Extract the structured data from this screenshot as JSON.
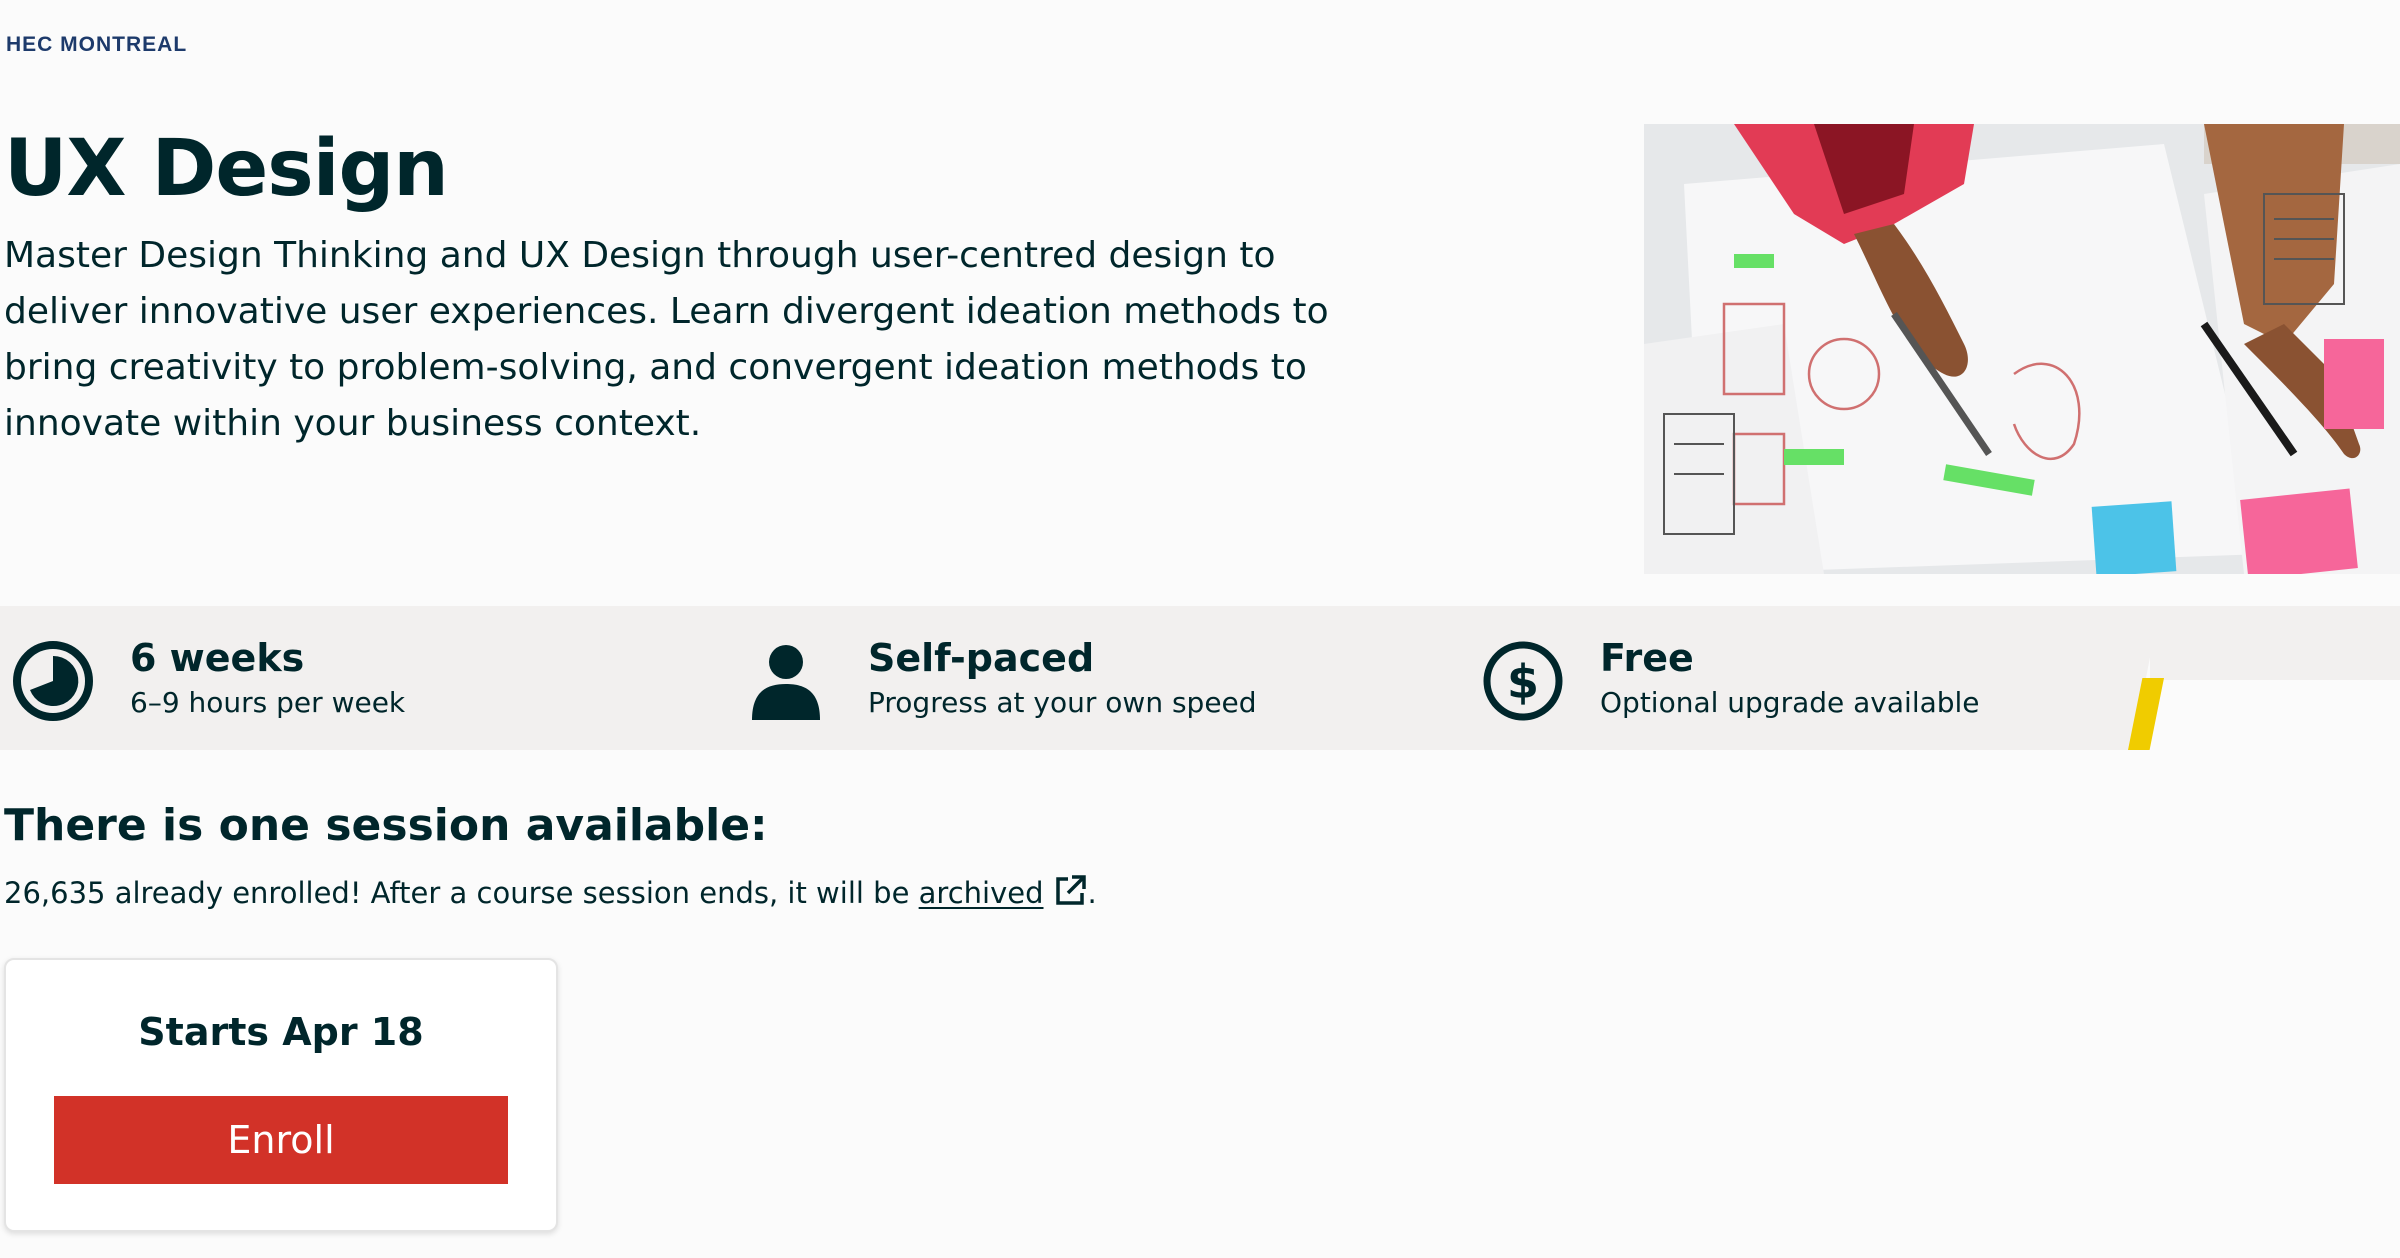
{
  "header": {
    "logo_text": "HEC MONTREAL"
  },
  "course": {
    "title": "UX Design",
    "description": "Master Design Thinking and UX Design through user-centred design to deliver innovative user experiences. Learn divergent ideation methods to bring creativity to problem-solving, and convergent ideation methods to innovate within your business context."
  },
  "stats": [
    {
      "icon": "clock-icon",
      "title": "6 weeks",
      "subtitle": "6–9 hours per week"
    },
    {
      "icon": "person-icon",
      "title": "Self-paced",
      "subtitle": "Progress at your own speed"
    },
    {
      "icon": "dollar-icon",
      "title": "Free",
      "subtitle": "Optional upgrade available"
    }
  ],
  "sessions": {
    "heading": "There is one session available:",
    "enrolled_text": "26,635 already enrolled! After a course session ends, it will be",
    "archived_link": "archived",
    "trailing": ".",
    "card": {
      "start_label": "Starts Apr 18",
      "enroll_label": "Enroll"
    }
  },
  "colors": {
    "text": "#00262b",
    "enroll_button": "#d23228",
    "accent_yellow": "#f0cc00",
    "band": "#f2f0ef"
  }
}
